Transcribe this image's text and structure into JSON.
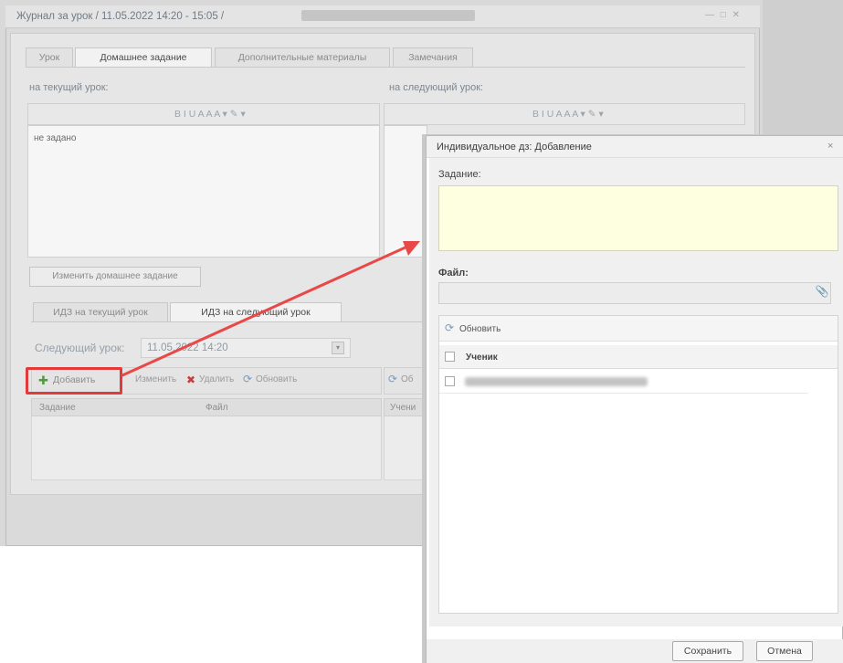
{
  "window": {
    "title": "Журнал за урок / 11.05.2022 14:20 - 15:05 /",
    "controls": "— □ ✕"
  },
  "tabs": [
    {
      "label": "Урок",
      "active": false
    },
    {
      "label": "Домашнее задание",
      "active": true
    },
    {
      "label": "Дополнительные материалы",
      "active": false
    },
    {
      "label": "Замечания",
      "active": false
    }
  ],
  "hw": {
    "current_label": "на текущий урок:",
    "next_label": "на следующий урок:",
    "toolbar": "B  I  U   A  A   A ▾  ✎ ▾",
    "current_text": "не задано",
    "change_button": "Изменить домашнее задание"
  },
  "subtabs": [
    {
      "label": "ИДЗ на текущий урок",
      "active": false
    },
    {
      "label": "ИДЗ на следующий урок",
      "active": true
    }
  ],
  "next_lesson": {
    "label": "Следующий урок:",
    "value": "11.05.2022 14:20"
  },
  "left_grid": {
    "add_button": "Добавить",
    "change_button": "Изменить",
    "delete_button": "Удалить",
    "refresh_button": "Обновить",
    "col_task": "Задание",
    "col_file": "Файл",
    "right_refresh": "Об",
    "right_col": "Учени"
  },
  "dialog": {
    "title": "Индивидуальное дз: Добавление",
    "close": "×",
    "task_label": "Задание:",
    "file_label": "Файл:",
    "file_icon": "paperclip-icon",
    "refresh_button": "Обновить",
    "column_student": "Ученик",
    "students": [
      ""
    ],
    "save_button": "Сохранить",
    "cancel_button": "Отмена"
  },
  "colors": {
    "highlight": "#e23a3a",
    "arrow": "#e84848",
    "task_field": "#fefee0"
  }
}
